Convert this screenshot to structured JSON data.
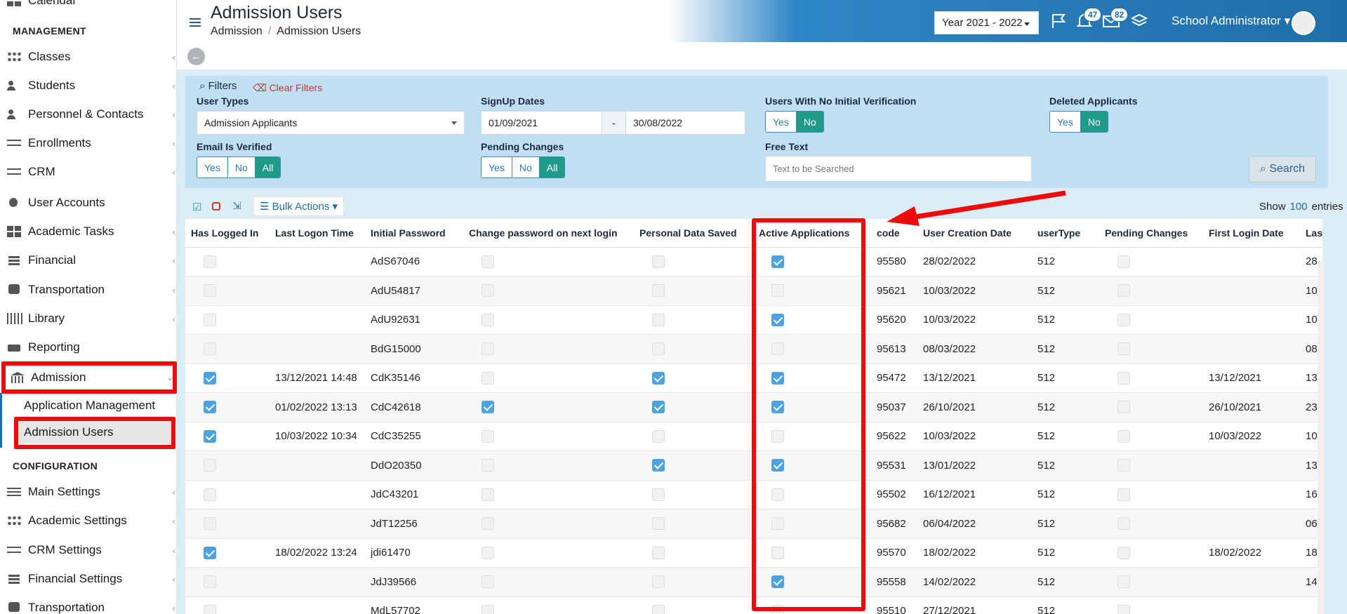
{
  "sidebar": {
    "top_partial": "Calendar",
    "sections": {
      "management": "MANAGEMENT",
      "configuration": "CONFIGURATION"
    },
    "items": [
      {
        "label": "Classes",
        "icon": "classes-icon"
      },
      {
        "label": "Students",
        "icon": "students-icon"
      },
      {
        "label": "Personnel & Contacts",
        "icon": "personnel-icon"
      },
      {
        "label": "Enrollments",
        "icon": "enrollments-icon"
      },
      {
        "label": "CRM",
        "icon": "crm-icon"
      },
      {
        "label": "User Accounts",
        "icon": "key-icon"
      },
      {
        "label": "Academic Tasks",
        "icon": "tasks-icon"
      },
      {
        "label": "Financial",
        "icon": "coins-icon"
      },
      {
        "label": "Transportation",
        "icon": "bus-icon"
      },
      {
        "label": "Library",
        "icon": "books-icon"
      },
      {
        "label": "Reporting",
        "icon": "printer-icon"
      },
      {
        "label": "Admission",
        "icon": "bank-icon"
      }
    ],
    "sub_items": [
      "Application Management",
      "Admission Users"
    ],
    "config_items": [
      {
        "label": "Main Settings",
        "icon": "sliders-icon"
      },
      {
        "label": "Academic Settings",
        "icon": "classes-icon"
      },
      {
        "label": "CRM Settings",
        "icon": "crm-icon"
      },
      {
        "label": "Financial Settings",
        "icon": "coins-icon"
      },
      {
        "label": "Transportation",
        "icon": "bus-icon"
      }
    ]
  },
  "header": {
    "title": "Admission Users",
    "breadcrumb": [
      "Admission",
      "Admission Users"
    ],
    "year": "Year 2021 - 2022",
    "notifications": "47",
    "messages": "82",
    "user": "School Administrator"
  },
  "filters": {
    "title": "Filters",
    "clear": "Clear Filters",
    "user_types_label": "User Types",
    "user_types_value": "Admission Applicants",
    "signup_label": "SignUp Dates",
    "signup_from": "01/09/2021",
    "signup_sep": "-",
    "signup_to": "30/08/2022",
    "no_verif_label": "Users With No Initial Verification",
    "deleted_label": "Deleted Applicants",
    "email_label": "Email Is Verified",
    "pending_label": "Pending Changes",
    "free_text_label": "Free Text",
    "free_text_placeholder": "Text to be Searched",
    "yes": "Yes",
    "no": "No",
    "all": "All",
    "search": "Search"
  },
  "toolbar": {
    "bulk": "Bulk Actions",
    "show": "Show",
    "entries_count": "100",
    "entries": "entries"
  },
  "table": {
    "columns": [
      "Has Logged In",
      "Last Logon Time",
      "Initial Password",
      "Change password on next login",
      "Personal Data Saved",
      "Active Applications",
      "code",
      "User Creation Date",
      "userType",
      "Pending Changes",
      "First Login Date",
      "Last"
    ],
    "rows": [
      {
        "logged": false,
        "logon": "",
        "pwd": "AdS67046",
        "change": false,
        "saved": false,
        "active": true,
        "code": "95580",
        "created": "28/02/2022",
        "type": "512",
        "pending": false,
        "first": "",
        "last": "28"
      },
      {
        "logged": false,
        "logon": "",
        "pwd": "AdU54817",
        "change": false,
        "saved": false,
        "active": false,
        "code": "95621",
        "created": "10/03/2022",
        "type": "512",
        "pending": false,
        "first": "",
        "last": "10"
      },
      {
        "logged": false,
        "logon": "",
        "pwd": "AdU92631",
        "change": false,
        "saved": false,
        "active": true,
        "code": "95620",
        "created": "10/03/2022",
        "type": "512",
        "pending": false,
        "first": "",
        "last": "10"
      },
      {
        "logged": false,
        "logon": "",
        "pwd": "BdG15000",
        "change": false,
        "saved": false,
        "active": false,
        "code": "95613",
        "created": "08/03/2022",
        "type": "512",
        "pending": false,
        "first": "",
        "last": "08"
      },
      {
        "logged": true,
        "logon": "13/12/2021 14:48",
        "pwd": "CdK35146",
        "change": false,
        "saved": true,
        "active": true,
        "code": "95472",
        "created": "13/12/2021",
        "type": "512",
        "pending": false,
        "first": "13/12/2021",
        "last": "13"
      },
      {
        "logged": true,
        "logon": "01/02/2022 13:13",
        "pwd": "CdC42618",
        "change": true,
        "saved": true,
        "active": true,
        "code": "95037",
        "created": "26/10/2021",
        "type": "512",
        "pending": false,
        "first": "26/10/2021",
        "last": "23"
      },
      {
        "logged": true,
        "logon": "10/03/2022 10:34",
        "pwd": "CdC35255",
        "change": false,
        "saved": false,
        "active": false,
        "code": "95622",
        "created": "10/03/2022",
        "type": "512",
        "pending": false,
        "first": "10/03/2022",
        "last": "10"
      },
      {
        "logged": false,
        "logon": "",
        "pwd": "DdO20350",
        "change": false,
        "saved": true,
        "active": true,
        "code": "95531",
        "created": "13/01/2022",
        "type": "512",
        "pending": false,
        "first": "",
        "last": "13"
      },
      {
        "logged": false,
        "logon": "",
        "pwd": "JdC43201",
        "change": false,
        "saved": false,
        "active": false,
        "code": "95502",
        "created": "16/12/2021",
        "type": "512",
        "pending": false,
        "first": "",
        "last": "16"
      },
      {
        "logged": false,
        "logon": "",
        "pwd": "JdT12256",
        "change": false,
        "saved": false,
        "active": false,
        "code": "95682",
        "created": "06/04/2022",
        "type": "512",
        "pending": false,
        "first": "",
        "last": "06"
      },
      {
        "logged": true,
        "logon": "18/02/2022 13:24",
        "pwd": "jdi61470",
        "change": false,
        "saved": false,
        "active": false,
        "code": "95570",
        "created": "18/02/2022",
        "type": "512",
        "pending": false,
        "first": "18/02/2022",
        "last": "18"
      },
      {
        "logged": false,
        "logon": "",
        "pwd": "JdJ39566",
        "change": false,
        "saved": false,
        "active": true,
        "code": "95558",
        "created": "14/02/2022",
        "type": "512",
        "pending": false,
        "first": "",
        "last": "14"
      },
      {
        "logged": false,
        "logon": "",
        "pwd": "MdL57702",
        "change": false,
        "saved": false,
        "active": false,
        "code": "95510",
        "created": "27/12/2021",
        "type": "512",
        "pending": false,
        "first": "",
        "last": ""
      }
    ]
  },
  "colors": {
    "accent": "#1f6ea8",
    "highlight": "#ee0b0b",
    "toggle_on": "#1f9b8a",
    "checkbox_on": "#4ca3e0"
  }
}
